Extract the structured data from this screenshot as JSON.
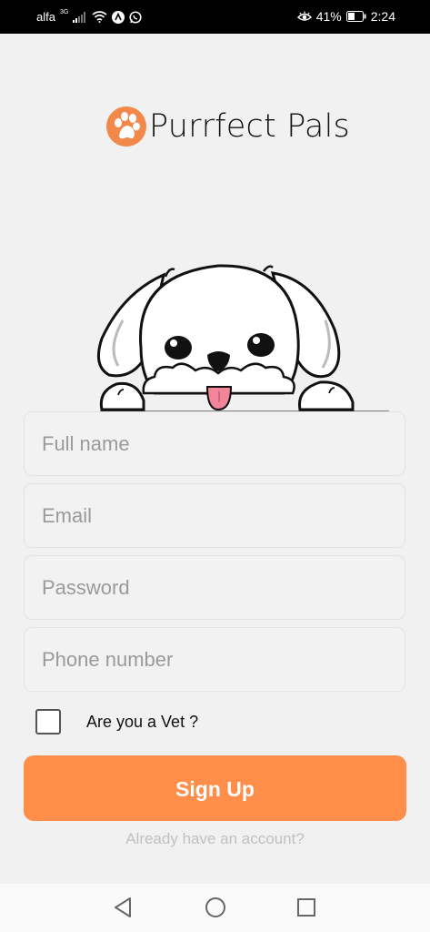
{
  "status_bar": {
    "carrier": "alfa",
    "network": "3G",
    "battery": "41%",
    "time": "2:24",
    "icons": [
      "signal-icon",
      "wifi-icon",
      "app-notification-icon",
      "whatsapp-icon",
      "eye-comfort-icon",
      "battery-icon"
    ]
  },
  "app": {
    "name": "Purrfect Pals",
    "logo_icon": "paw-icon",
    "brand_color": "#fe8e49"
  },
  "form": {
    "full_name": {
      "placeholder": "Full name",
      "value": ""
    },
    "email": {
      "placeholder": "Email",
      "value": ""
    },
    "password": {
      "placeholder": "Password",
      "value": ""
    },
    "phone": {
      "placeholder": "Phone number",
      "value": ""
    },
    "vet_checkbox": {
      "label": "Are you a Vet ?",
      "checked": false
    },
    "signup_label": "Sign Up",
    "signin_link": "Already have an account?"
  },
  "nav_bar": {
    "icons": [
      "back-icon",
      "home-icon",
      "recents-icon"
    ]
  }
}
